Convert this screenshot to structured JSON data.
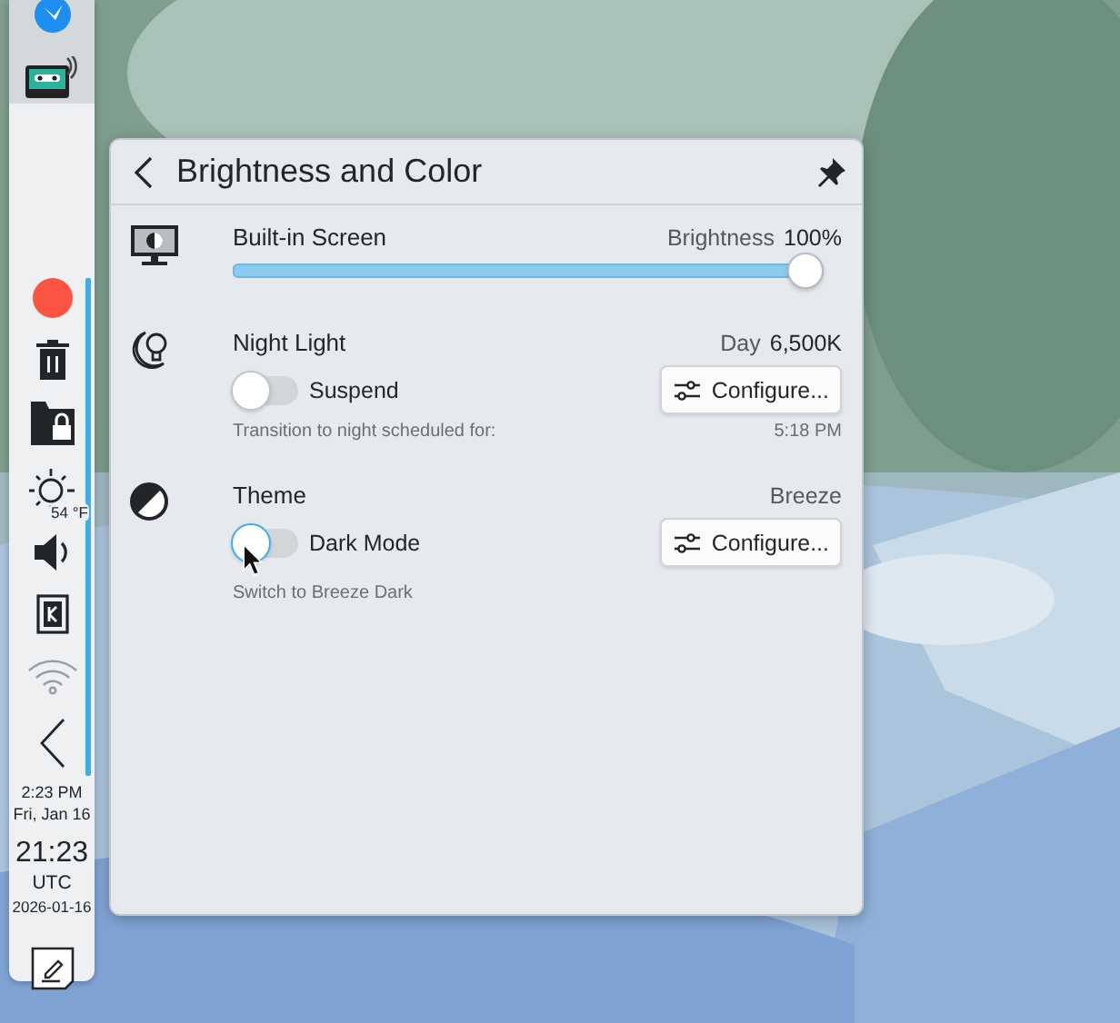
{
  "sidebar": {
    "weather": "54 °F",
    "clock": {
      "time": "2:23 PM",
      "date": "Fri, Jan 16",
      "utc_time": "21:23",
      "timezone": "UTC",
      "utc_date": "2026-01-16"
    }
  },
  "popup": {
    "title": "Brightness and Color",
    "sections": [
      {
        "kind": "slider",
        "title": "Built-in Screen",
        "status": "Brightness",
        "reading": "100%",
        "level": 1
      },
      {
        "kind": "toggle",
        "title": "Night Light",
        "status": "Day",
        "reading": "6,500K",
        "toggle": {
          "label": "Suspend",
          "on": false
        },
        "button": "Configure...",
        "note": "Transition to night scheduled for:",
        "note_value": "5:18 PM"
      },
      {
        "kind": "toggle",
        "title": "Theme",
        "status": "Breeze",
        "toggle": {
          "label": "Dark Mode",
          "on": false
        },
        "button": "Configure...",
        "note": "Switch to Breeze Dark"
      }
    ]
  }
}
